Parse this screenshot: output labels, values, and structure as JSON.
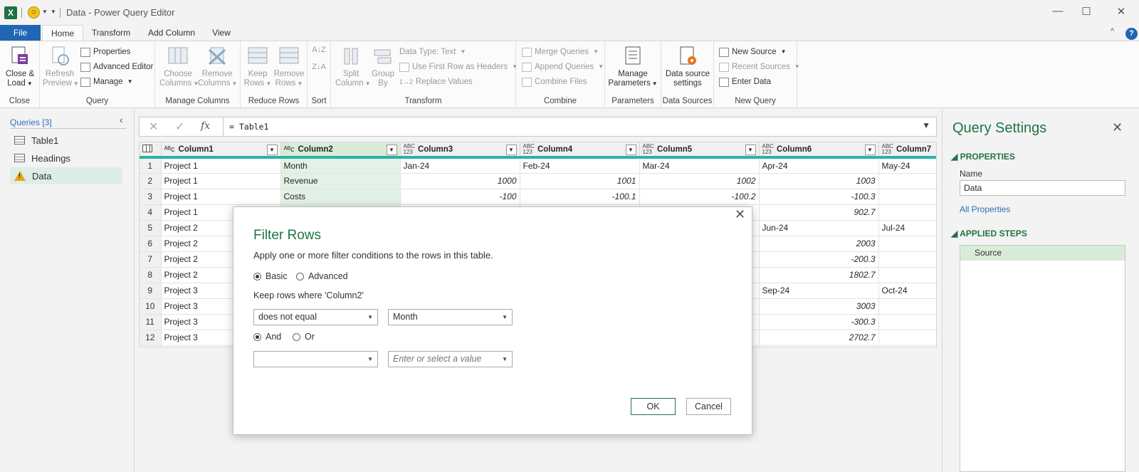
{
  "window": {
    "title": "Data - Power Query Editor",
    "minimize": "—",
    "maximize": "☐",
    "close": "✕"
  },
  "menu": {
    "file": "File",
    "tabs": [
      "Home",
      "Transform",
      "Add Column",
      "View"
    ],
    "help": "?",
    "collapse": "^"
  },
  "ribbon": {
    "close_load": "Close &",
    "close_load2": "Load",
    "close_group": "Close",
    "refresh": "Refresh",
    "refresh2": "Preview",
    "properties": "Properties",
    "advanced_editor": "Advanced Editor",
    "manage": "Manage",
    "query_group": "Query",
    "choose_columns": "Choose",
    "choose_columns2": "Columns",
    "remove_columns": "Remove",
    "remove_columns2": "Columns",
    "manage_columns_group": "Manage Columns",
    "keep_rows": "Keep",
    "keep_rows2": "Rows",
    "remove_rows": "Remove",
    "remove_rows2": "Rows",
    "reduce_rows_group": "Reduce Rows",
    "sort_group": "Sort",
    "split_column": "Split",
    "split_column2": "Column",
    "group_by": "Group",
    "group_by2": "By",
    "data_type": "Data Type: Text",
    "first_row_headers": "Use First Row as Headers",
    "replace_values": "Replace Values",
    "transform_group": "Transform",
    "merge_queries": "Merge Queries",
    "append_queries": "Append Queries",
    "combine_files": "Combine Files",
    "combine_group": "Combine",
    "manage_parameters": "Manage",
    "manage_parameters2": "Parameters",
    "parameters_group": "Parameters",
    "data_source_settings": "Data source",
    "data_source_settings2": "settings",
    "data_sources_group": "Data Sources",
    "new_source": "New Source",
    "recent_sources": "Recent Sources",
    "enter_data": "Enter Data",
    "new_query_group": "New Query"
  },
  "queries": {
    "title": "Queries [3]",
    "items": [
      "Table1",
      "Headings",
      "Data"
    ]
  },
  "formula": {
    "cancel": "✕",
    "commit": "✓",
    "fx": "fx",
    "value": "= Table1"
  },
  "grid": {
    "columns": [
      {
        "type": "ABC",
        "name": "Column1"
      },
      {
        "type": "ABC",
        "name": "Column2"
      },
      {
        "type": "ABC123",
        "name": "Column3"
      },
      {
        "type": "ABC123",
        "name": "Column4"
      },
      {
        "type": "ABC123",
        "name": "Column5"
      },
      {
        "type": "ABC123",
        "name": "Column6"
      },
      {
        "type": "ABC123",
        "name": "Column7"
      }
    ],
    "rows": [
      [
        "1",
        "Project 1",
        "Month",
        "Jan-24",
        "Feb-24",
        "Mar-24",
        "Apr-24",
        "May-24"
      ],
      [
        "2",
        "Project 1",
        "Revenue",
        "1000",
        "1001",
        "1002",
        "1003",
        ""
      ],
      [
        "3",
        "Project 1",
        "Costs",
        "-100",
        "-100.1",
        "-100.2",
        "-100.3",
        ""
      ],
      [
        "4",
        "Project 1",
        "",
        "",
        "",
        "",
        "902.7",
        ""
      ],
      [
        "5",
        "Project 2",
        "",
        "",
        "",
        "",
        "Jun-24",
        "Jul-24"
      ],
      [
        "6",
        "Project 2",
        "",
        "",
        "",
        "",
        "2003",
        ""
      ],
      [
        "7",
        "Project 2",
        "",
        "",
        "",
        "",
        "-200.3",
        ""
      ],
      [
        "8",
        "Project 2",
        "",
        "",
        "",
        "",
        "1802.7",
        ""
      ],
      [
        "9",
        "Project 3",
        "",
        "",
        "",
        "",
        "Sep-24",
        "Oct-24"
      ],
      [
        "10",
        "Project 3",
        "",
        "",
        "",
        "",
        "3003",
        ""
      ],
      [
        "11",
        "Project 3",
        "",
        "",
        "",
        "",
        "-300.3",
        ""
      ],
      [
        "12",
        "Project 3",
        "",
        "",
        "",
        "",
        "2702.7",
        ""
      ]
    ]
  },
  "query_settings": {
    "title": "Query Settings",
    "close": "✕",
    "properties": "PROPERTIES",
    "name_label": "Name",
    "name_value": "Data",
    "all_properties": "All Properties",
    "applied_steps": "APPLIED STEPS",
    "steps": [
      "Source"
    ]
  },
  "dialog": {
    "title": "Filter Rows",
    "close": "✕",
    "description": "Apply one or more filter conditions to the rows in this table.",
    "basic": "Basic",
    "advanced": "Advanced",
    "keep_rows": "Keep rows where 'Column2'",
    "operator1": "does not equal",
    "value1": "Month",
    "and": "And",
    "or": "Or",
    "operator2": "",
    "value2_placeholder": "Enter or select a value",
    "ok": "OK",
    "cancel": "Cancel"
  },
  "colors": {
    "accent_green": "#217346",
    "file_blue": "#2165b5",
    "header_teal": "#2ab3a6"
  }
}
